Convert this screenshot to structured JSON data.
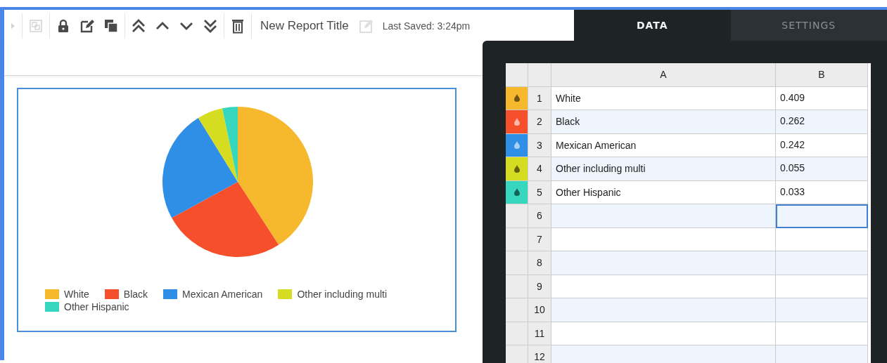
{
  "toolbar": {
    "groups": [
      [
        {
          "kind": "caret",
          "disabled": true
        }
      ],
      [
        {
          "kind": "group",
          "disabled": true
        }
      ],
      [
        {
          "kind": "lock",
          "disabled": false
        },
        {
          "kind": "edit",
          "disabled": false
        },
        {
          "kind": "copy",
          "disabled": false
        }
      ],
      [
        {
          "kind": "top",
          "disabled": false
        },
        {
          "kind": "up",
          "disabled": false
        },
        {
          "kind": "down",
          "disabled": false
        },
        {
          "kind": "bottom",
          "disabled": false
        }
      ],
      [
        {
          "kind": "trash",
          "disabled": false
        }
      ]
    ],
    "title": "New Report Title",
    "title_edit": {
      "disabled": true
    },
    "last_saved": "Last Saved: 3:24pm"
  },
  "tabs": [
    {
      "label": "DATA",
      "selected": true
    },
    {
      "label": "SETTINGS",
      "selected": false
    }
  ],
  "chart": {
    "chart_data": {
      "type": "pie",
      "categories": [
        "White",
        "Black",
        "Mexican American",
        "Other including multi",
        "Other Hispanic"
      ],
      "values": [
        0.409,
        0.262,
        0.242,
        0.055,
        0.033
      ],
      "colors": [
        "#f6b82c",
        "#f5502b",
        "#2f8ee6",
        "#d5dc21",
        "#37d7bf"
      ]
    }
  },
  "grid": {
    "columns": [
      "A",
      "B"
    ],
    "rows": [
      {
        "number": "1",
        "label": "White",
        "value": "0.409",
        "color": "#f6b82c",
        "cell_selected": false
      },
      {
        "number": "2",
        "label": "Black",
        "value": "0.262",
        "color": "#f5502b",
        "cell_selected": false
      },
      {
        "number": "3",
        "label": "Mexican American",
        "value": "0.242",
        "color": "#2f8ee6",
        "cell_selected": false
      },
      {
        "number": "4",
        "label": "Other including multi",
        "value": "0.055",
        "color": "#d5dc21",
        "cell_selected": false
      },
      {
        "number": "5",
        "label": "Other Hispanic",
        "value": "0.033",
        "color": "#37d7bf",
        "cell_selected": false
      },
      {
        "number": "6",
        "cell_selected": true
      },
      {
        "number": "7",
        "cell_selected": false
      },
      {
        "number": "8",
        "cell_selected": false
      },
      {
        "number": "9",
        "cell_selected": false
      },
      {
        "number": "10",
        "cell_selected": false
      },
      {
        "number": "11",
        "cell_selected": false
      },
      {
        "number": "12",
        "cell_selected": false
      }
    ]
  }
}
